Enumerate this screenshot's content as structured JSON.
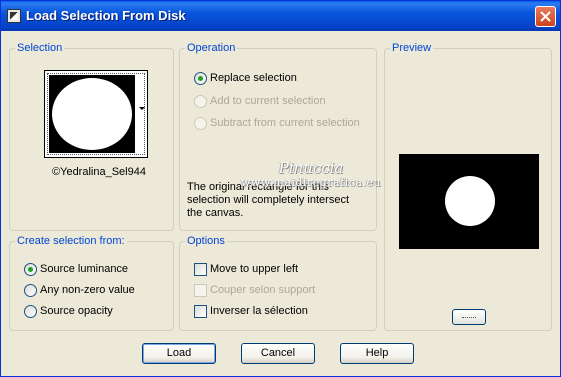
{
  "window": {
    "title": "Load Selection From Disk"
  },
  "selection": {
    "label": "Selection",
    "thumbnail_caption": "©Yedralina_Sel944"
  },
  "operation": {
    "label": "Operation",
    "options": [
      {
        "label": "Replace selection",
        "checked": true,
        "enabled": true
      },
      {
        "label": "Add to current selection",
        "checked": false,
        "enabled": false
      },
      {
        "label": "Subtract from current selection",
        "checked": false,
        "enabled": false
      }
    ],
    "info_text": "The original rectangle for this selection will completely intersect the canvas."
  },
  "preview": {
    "label": "Preview"
  },
  "create_from": {
    "label": "Create selection from:",
    "options": [
      {
        "label": "Source luminance",
        "checked": true
      },
      {
        "label": "Any non-zero value",
        "checked": false
      },
      {
        "label": "Source opacity",
        "checked": false
      }
    ]
  },
  "options": {
    "label": "Options",
    "items": [
      {
        "label": "Move to upper left",
        "checked": false,
        "enabled": true
      },
      {
        "label": "Couper selon support",
        "checked": false,
        "enabled": false
      },
      {
        "label": "Inverser la sélection",
        "checked": false,
        "enabled": true
      }
    ]
  },
  "buttons": {
    "load": "Load",
    "cancel": "Cancel",
    "help": "Help"
  },
  "watermark": {
    "line1": "Pinuccia",
    "line2": "www.maidiregrafica.eu"
  },
  "colors": {
    "title_bar": "#0855DD",
    "dialog_bg": "#ECE9D8",
    "group_label": "#0046D5",
    "radio_dot": "#21A121"
  }
}
